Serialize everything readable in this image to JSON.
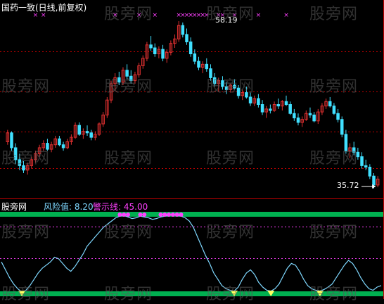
{
  "top": {
    "title": "国药一致(日线,前复权)",
    "high_label": "58.19",
    "low_label": "35.72"
  },
  "bottom": {
    "indicator_name": "股旁网",
    "risk_label": "风险值: 8.20",
    "warn_label": "警示线: 45.00"
  },
  "watermark": "股旁网",
  "colors": {
    "background": "#000000",
    "up_candle": "#e03030",
    "down_candle": "#40e0ff",
    "grid_red": "#c00000",
    "band_green": "#00b050",
    "risk_line": "#7fd8ff",
    "marker_magenta": "#ff40ff",
    "low_marker_yellow": "#ffff60"
  },
  "chart_data": [
    {
      "type": "candlestick",
      "title": "国药一致(日线,前复权)",
      "annotations": [
        "58.19",
        "35.72"
      ],
      "ohlc": [
        [
          42.0,
          43.6,
          41.6,
          43.2
        ],
        [
          43.2,
          43.4,
          40.8,
          41.2
        ],
        [
          41.2,
          41.8,
          39.0,
          39.6
        ],
        [
          39.6,
          40.4,
          38.2,
          38.8
        ],
        [
          38.8,
          39.4,
          37.8,
          38.2
        ],
        [
          38.2,
          39.2,
          37.6,
          38.8
        ],
        [
          38.8,
          40.0,
          38.4,
          39.6
        ],
        [
          39.6,
          40.8,
          39.2,
          40.4
        ],
        [
          40.4,
          41.6,
          40.0,
          41.2
        ],
        [
          41.2,
          42.2,
          40.8,
          41.8
        ],
        [
          41.8,
          42.4,
          40.8,
          41.0
        ],
        [
          41.0,
          42.0,
          40.6,
          41.6
        ],
        [
          41.6,
          42.8,
          41.2,
          42.4
        ],
        [
          42.4,
          42.8,
          41.4,
          41.6
        ],
        [
          41.6,
          42.0,
          40.8,
          41.2
        ],
        [
          41.2,
          42.4,
          41.0,
          42.0
        ],
        [
          42.0,
          43.0,
          41.6,
          42.6
        ],
        [
          42.6,
          44.6,
          42.4,
          44.2
        ],
        [
          44.2,
          44.6,
          42.8,
          43.0
        ],
        [
          43.0,
          43.8,
          42.4,
          43.4
        ],
        [
          43.4,
          44.2,
          42.8,
          43.2
        ],
        [
          43.2,
          43.6,
          42.2,
          42.6
        ],
        [
          42.6,
          43.4,
          42.2,
          43.0
        ],
        [
          43.0,
          44.6,
          42.8,
          44.4
        ],
        [
          44.4,
          46.0,
          44.0,
          45.6
        ],
        [
          45.6,
          48.0,
          45.2,
          47.6
        ],
        [
          47.6,
          50.2,
          47.2,
          49.8
        ],
        [
          49.8,
          51.2,
          48.8,
          50.6
        ],
        [
          50.6,
          51.4,
          49.6,
          50.0
        ],
        [
          50.0,
          52.0,
          49.6,
          51.6
        ],
        [
          51.6,
          52.4,
          50.4,
          50.8
        ],
        [
          50.8,
          51.6,
          49.8,
          50.2
        ],
        [
          50.2,
          51.4,
          49.8,
          51.0
        ],
        [
          51.0,
          52.6,
          50.6,
          52.2
        ],
        [
          52.2,
          53.6,
          51.8,
          53.2
        ],
        [
          53.2,
          55.4,
          52.8,
          55.0
        ],
        [
          55.0,
          56.2,
          54.2,
          54.6
        ],
        [
          54.6,
          55.2,
          53.4,
          53.8
        ],
        [
          53.8,
          54.8,
          53.2,
          54.4
        ],
        [
          54.4,
          55.0,
          52.8,
          53.2
        ],
        [
          53.2,
          54.4,
          52.6,
          54.0
        ],
        [
          54.0,
          55.6,
          53.6,
          55.2
        ],
        [
          55.2,
          56.4,
          54.6,
          55.8
        ],
        [
          55.8,
          58.19,
          55.4,
          57.6
        ],
        [
          57.6,
          58.0,
          56.0,
          56.4
        ],
        [
          56.4,
          57.2,
          55.0,
          55.4
        ],
        [
          55.4,
          56.0,
          53.4,
          53.8
        ],
        [
          53.8,
          54.4,
          52.4,
          52.8
        ],
        [
          52.8,
          53.4,
          51.6,
          52.0
        ],
        [
          52.0,
          52.8,
          51.2,
          52.4
        ],
        [
          52.4,
          53.2,
          51.4,
          51.8
        ],
        [
          51.8,
          52.4,
          50.2,
          50.6
        ],
        [
          50.6,
          51.2,
          49.4,
          49.8
        ],
        [
          49.8,
          50.6,
          48.8,
          50.2
        ],
        [
          50.2,
          50.8,
          49.0,
          49.4
        ],
        [
          49.4,
          50.0,
          48.4,
          49.0
        ],
        [
          49.0,
          49.8,
          48.6,
          49.6
        ],
        [
          49.6,
          50.4,
          49.0,
          49.2
        ],
        [
          49.2,
          49.6,
          47.8,
          48.2
        ],
        [
          48.2,
          49.0,
          47.6,
          48.6
        ],
        [
          48.6,
          49.4,
          47.8,
          48.0
        ],
        [
          48.0,
          48.6,
          46.8,
          47.2
        ],
        [
          47.2,
          48.2,
          46.8,
          47.8
        ],
        [
          47.8,
          48.4,
          46.6,
          47.0
        ],
        [
          47.0,
          47.6,
          45.6,
          46.0
        ],
        [
          46.0,
          46.8,
          45.2,
          46.4
        ],
        [
          46.4,
          47.0,
          45.8,
          46.2
        ],
        [
          46.2,
          47.4,
          46.0,
          47.0
        ],
        [
          47.0,
          47.8,
          46.4,
          46.8
        ],
        [
          46.8,
          47.6,
          46.2,
          47.4
        ],
        [
          47.4,
          48.2,
          46.8,
          47.0
        ],
        [
          47.0,
          47.4,
          45.6,
          45.8
        ],
        [
          45.8,
          46.4,
          44.8,
          45.2
        ],
        [
          45.2,
          45.8,
          44.2,
          44.6
        ],
        [
          44.6,
          45.4,
          44.0,
          45.0
        ],
        [
          45.0,
          46.2,
          44.8,
          45.8
        ],
        [
          45.8,
          46.6,
          45.2,
          45.6
        ],
        [
          45.6,
          46.0,
          44.6,
          44.8
        ],
        [
          44.8,
          46.4,
          44.4,
          46.0
        ],
        [
          46.0,
          47.2,
          45.6,
          46.8
        ],
        [
          46.8,
          47.8,
          46.4,
          47.4
        ],
        [
          47.4,
          48.0,
          46.6,
          46.8
        ],
        [
          46.8,
          47.2,
          45.6,
          45.8
        ],
        [
          45.8,
          46.4,
          44.6,
          45.0
        ],
        [
          45.0,
          45.4,
          42.6,
          43.0
        ],
        [
          43.0,
          43.6,
          40.4,
          40.8
        ],
        [
          40.8,
          41.8,
          39.8,
          41.2
        ],
        [
          41.2,
          42.0,
          40.2,
          40.6
        ],
        [
          40.6,
          41.2,
          39.6,
          40.0
        ],
        [
          40.0,
          40.6,
          38.4,
          38.8
        ],
        [
          38.8,
          39.6,
          38.2,
          38.6
        ],
        [
          38.6,
          39.0,
          37.0,
          37.4
        ],
        [
          37.4,
          37.8,
          35.72,
          36.2
        ],
        [
          36.2,
          37.4,
          35.9,
          37.0
        ]
      ],
      "buy_markers_x_index": [
        7,
        9,
        27,
        33,
        37,
        43,
        44,
        45,
        46,
        47,
        48,
        49,
        50,
        53,
        54,
        57,
        63,
        70
      ]
    },
    {
      "type": "line",
      "title": "股旁网",
      "labels": [
        "风险值: 8.20",
        "警示线: 45.00"
      ],
      "ylim": [
        0,
        100
      ],
      "warning_line": 45,
      "series": [
        {
          "name": "风险值",
          "values": [
            40,
            30,
            20,
            12,
            6,
            2,
            4,
            10,
            18,
            26,
            32,
            36,
            40,
            46,
            44,
            38,
            32,
            28,
            34,
            42,
            50,
            60,
            66,
            72,
            78,
            84,
            88,
            92,
            96,
            98,
            99,
            97,
            95,
            96,
            98,
            97,
            96,
            94,
            95,
            97,
            98,
            99,
            100,
            99,
            98,
            96,
            92,
            84,
            72,
            60,
            48,
            38,
            26,
            18,
            10,
            6,
            4,
            3,
            8,
            18,
            26,
            30,
            24,
            14,
            8,
            4,
            3,
            6,
            12,
            22,
            32,
            38,
            36,
            28,
            18,
            10,
            6,
            4,
            3,
            5,
            8,
            12,
            20,
            28,
            36,
            42,
            38,
            30,
            20,
            12,
            6,
            4,
            8,
            10
          ]
        }
      ]
    }
  ]
}
